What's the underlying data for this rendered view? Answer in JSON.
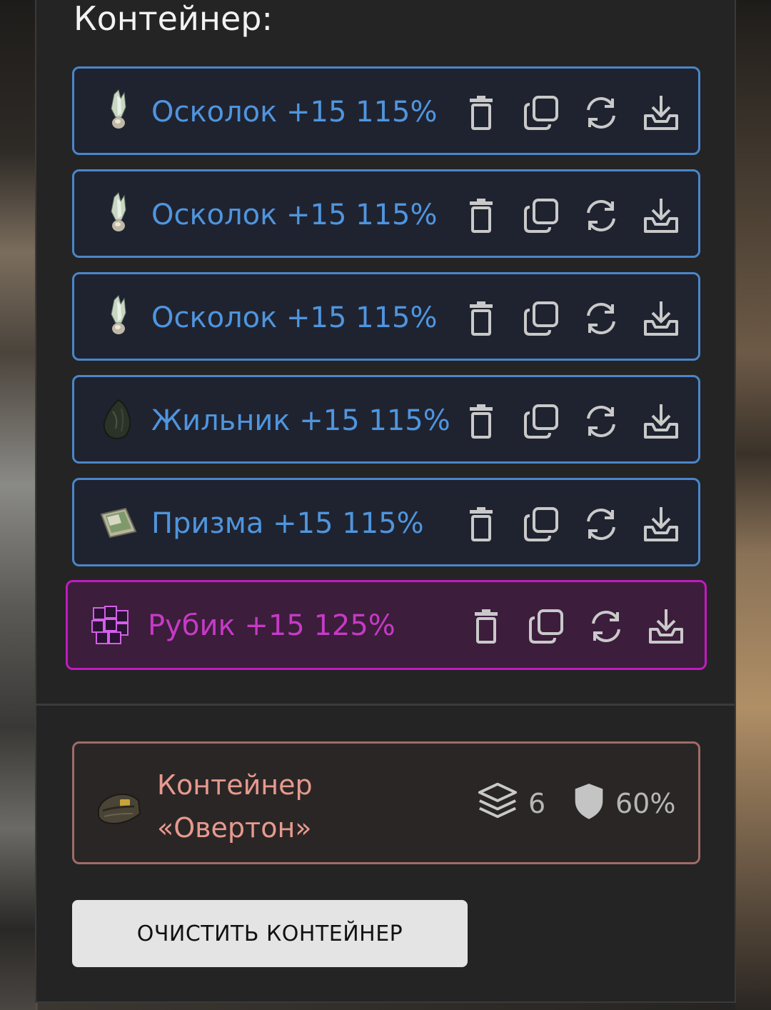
{
  "panel": {
    "title": "Контейнер:"
  },
  "items": [
    {
      "name": "Осколок +15 115%",
      "icon": "shard-crystal-icon"
    },
    {
      "name": "Осколок +15 115%",
      "icon": "shard-crystal-icon"
    },
    {
      "name": "Осколок +15 115%",
      "icon": "shard-crystal-icon"
    },
    {
      "name": "Жильник +15 115%",
      "icon": "vein-stone-icon"
    },
    {
      "name": "Призма +15 115%",
      "icon": "prism-icon"
    },
    {
      "name": "Рубик +15 125%",
      "icon": "rubik-cube-icon"
    }
  ],
  "actions": [
    "trash-icon",
    "copy-icon",
    "refresh-icon",
    "download-icon"
  ],
  "colors": {
    "common_border": "#4a86c8",
    "common_text": "#4f95de",
    "rare_border": "#c21ac2",
    "rare_text": "#c63ac4",
    "container_border": "#9e6c68",
    "container_text": "#e79a8e"
  },
  "container": {
    "name": "Контейнер «Овертон»",
    "slots": "6",
    "protection": "60%",
    "slots_icon": "layers-icon",
    "protection_icon": "shield-icon"
  },
  "clear_button": {
    "label": "ОЧИСТИТЬ КОНТЕЙНЕР"
  }
}
